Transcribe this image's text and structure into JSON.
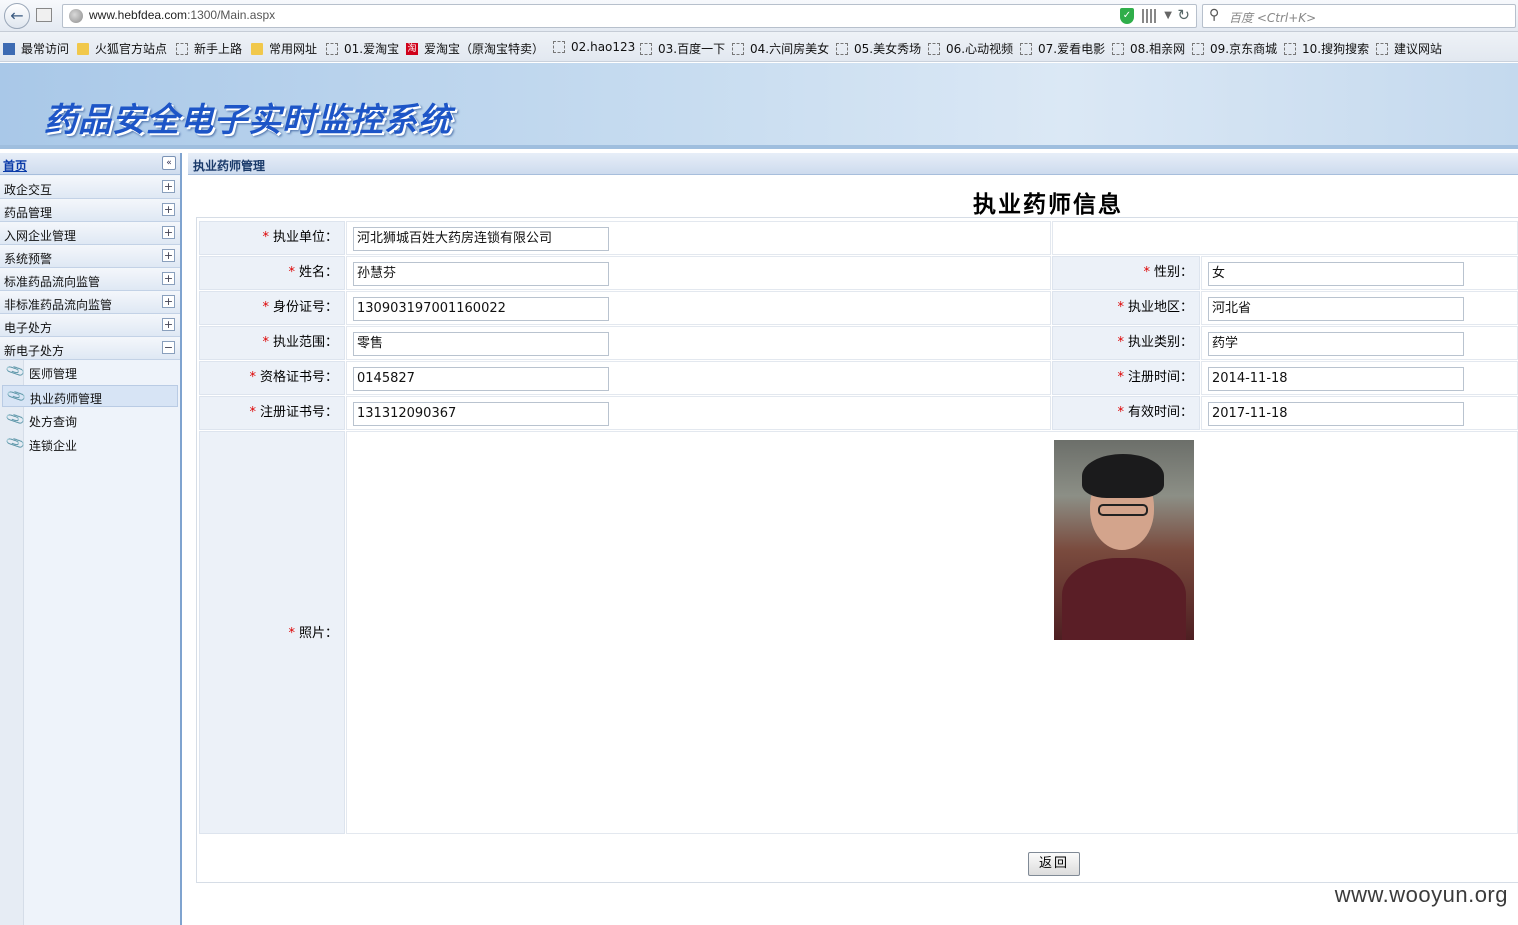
{
  "browser": {
    "url_domain": "www.hebfdea.com",
    "url_path": ":1300/Main.aspx",
    "search_placeholder": "百度 <Ctrl+K>",
    "bookmarks": [
      "最常访问",
      "火狐官方站点",
      "新手上路",
      "常用网址",
      "01.爱淘宝",
      "爱淘宝（原淘宝特卖）",
      "02.hao123",
      "03.百度一下",
      "04.六间房美女",
      "05.美女秀场",
      "06.心动视频",
      "07.爱看电影",
      "08.相亲网",
      "09.京东商城",
      "10.搜狗搜索",
      "建议网站"
    ]
  },
  "app": {
    "title": "药品安全电子实时监控系统"
  },
  "sidebar": {
    "home": "首页",
    "menus": [
      {
        "label": "政企交互",
        "toggle": "+"
      },
      {
        "label": "药品管理",
        "toggle": "+"
      },
      {
        "label": "入网企业管理",
        "toggle": "+"
      },
      {
        "label": "系统预警",
        "toggle": "+"
      },
      {
        "label": "标准药品流向监管",
        "toggle": "+"
      },
      {
        "label": "非标准药品流向监管",
        "toggle": "+"
      },
      {
        "label": "电子处方",
        "toggle": "+"
      },
      {
        "label": "新电子处方",
        "toggle": "−"
      }
    ],
    "sub_items": [
      "医师管理",
      "执业药师管理",
      "处方查询",
      "连锁企业"
    ],
    "active_sub": "执业药师管理"
  },
  "main": {
    "breadcrumb": "执业药师管理",
    "page_title": "执业药师信息",
    "fields": {
      "unit_label": "执业单位：",
      "unit_value": "河北狮城百姓大药房连锁有限公司",
      "name_label": "姓名：",
      "name_value": "孙慧芬",
      "gender_label": "性别：",
      "gender_value": "女",
      "id_label": "身份证号：",
      "id_value": "130903197001160022",
      "region_label": "执业地区：",
      "region_value": "河北省",
      "scope_label": "执业范围：",
      "scope_value": "零售",
      "category_label": "执业类别：",
      "category_value": "药学",
      "qual_label": "资格证书号：",
      "qual_value": "0145827",
      "regtime_label": "注册时间：",
      "regtime_value": "2014-11-18",
      "regno_label": "注册证书号：",
      "regno_value": "131312090367",
      "valid_label": "有效时间：",
      "valid_value": "2017-11-18",
      "photo_label": "照片："
    },
    "required_mark": "*",
    "return_button": "返回"
  },
  "watermark": "www.wooyun.org",
  "colors": {
    "banner_title": "#1d55c7",
    "label_bg": "#ecf1f8",
    "required": "#dd0000",
    "sidebar_link": "#0a3aa8"
  }
}
